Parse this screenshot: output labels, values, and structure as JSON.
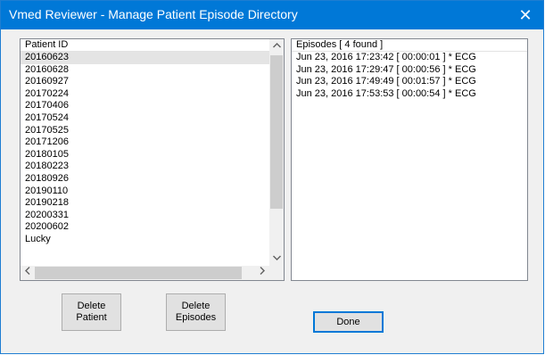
{
  "window": {
    "title": "Vmed Reviewer - Manage Patient Episode Directory",
    "close_glyph": "✕"
  },
  "patients": {
    "header": "Patient ID",
    "items": [
      "20160623",
      "20160628",
      "20160927",
      "20170224",
      "20170406",
      "20170524",
      "20170525",
      "20171206",
      "20180105",
      "20180223",
      "20180926",
      "20190110",
      "20190218",
      "20200331",
      "20200602",
      "Lucky"
    ],
    "selected_index": 0
  },
  "episodes": {
    "header": "Episodes [ 4 found ]",
    "items": [
      "Jun 23, 2016  17:23:42  [ 00:00:01 ] * ECG",
      "Jun 23, 2016  17:29:47  [ 00:00:56 ] * ECG",
      "Jun 23, 2016  17:49:49  [ 00:01:57 ] * ECG",
      "Jun 23, 2016  17:53:53  [ 00:00:54 ] * ECG"
    ]
  },
  "buttons": {
    "delete_patient": "Delete\nPatient",
    "delete_episodes": "Delete\nEpisodes",
    "done": "Done"
  },
  "colors": {
    "titlebar": "#0078d7",
    "selection": "#e4e4e4"
  },
  "icons": {
    "close": "close-icon",
    "up": "chevron-up-icon",
    "down": "chevron-down-icon",
    "left": "chevron-left-icon",
    "right": "chevron-right-icon"
  }
}
